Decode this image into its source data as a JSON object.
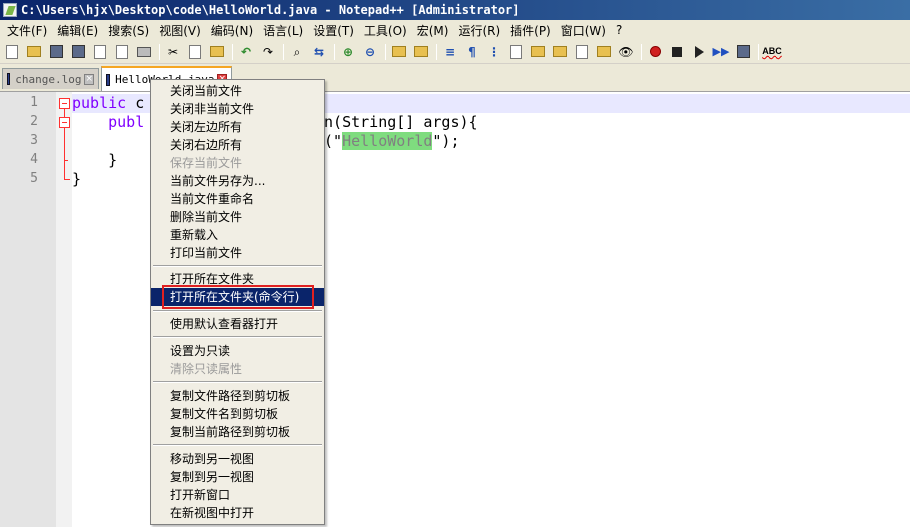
{
  "window": {
    "title": "C:\\Users\\hjx\\Desktop\\code\\HelloWorld.java - Notepad++ [Administrator]"
  },
  "menubar": [
    "文件(F)",
    "编辑(E)",
    "搜索(S)",
    "视图(V)",
    "编码(N)",
    "语言(L)",
    "设置(T)",
    "工具(O)",
    "宏(M)",
    "运行(R)",
    "插件(P)",
    "窗口(W)",
    "?"
  ],
  "tabs": [
    {
      "label": "change.log",
      "active": false
    },
    {
      "label": "HelloWorld.java",
      "active": true
    }
  ],
  "editor": {
    "line_numbers": [
      "1",
      "2",
      "3",
      "4",
      "5"
    ],
    "lines": [
      {
        "kw": "public",
        "rest": " c"
      },
      {
        "pre": "    ",
        "kw": "publ",
        "post": "",
        "tail": "in(String[] args){"
      },
      {
        "tail_pre": "n(\"",
        "str": "HelloWorld",
        "tail_post": "\");"
      },
      {
        "pre": "    }"
      },
      {
        "pre": "}"
      }
    ]
  },
  "context_menu": {
    "groups": [
      [
        {
          "label": "关闭当前文件",
          "enabled": true
        },
        {
          "label": "关闭非当前文件",
          "enabled": true
        },
        {
          "label": "关闭左边所有",
          "enabled": true
        },
        {
          "label": "关闭右边所有",
          "enabled": true
        },
        {
          "label": "保存当前文件",
          "enabled": false
        },
        {
          "label": "当前文件另存为...",
          "enabled": true
        },
        {
          "label": "当前文件重命名",
          "enabled": true
        },
        {
          "label": "删除当前文件",
          "enabled": true
        },
        {
          "label": "重新载入",
          "enabled": true
        },
        {
          "label": "打印当前文件",
          "enabled": true
        }
      ],
      [
        {
          "label": "打开所在文件夹",
          "enabled": true
        },
        {
          "label": "打开所在文件夹(命令行)",
          "enabled": true,
          "highlighted": true
        }
      ],
      [
        {
          "label": "使用默认查看器打开",
          "enabled": true
        }
      ],
      [
        {
          "label": "设置为只读",
          "enabled": true
        },
        {
          "label": "清除只读属性",
          "enabled": false
        }
      ],
      [
        {
          "label": "复制文件路径到剪切板",
          "enabled": true
        },
        {
          "label": "复制文件名到剪切板",
          "enabled": true
        },
        {
          "label": "复制当前路径到剪切板",
          "enabled": true
        }
      ],
      [
        {
          "label": "移动到另一视图",
          "enabled": true
        },
        {
          "label": "复制到另一视图",
          "enabled": true
        },
        {
          "label": "打开新窗口",
          "enabled": true
        },
        {
          "label": "在新视图中打开",
          "enabled": true
        }
      ]
    ]
  },
  "colors": {
    "title_bar": "#0a246a",
    "highlight": "#0a246a",
    "keyword": "#8000ff",
    "string_bg": "#7fdc7f",
    "fold_marker": "#ff3030",
    "annotation_box": "#e02020"
  }
}
